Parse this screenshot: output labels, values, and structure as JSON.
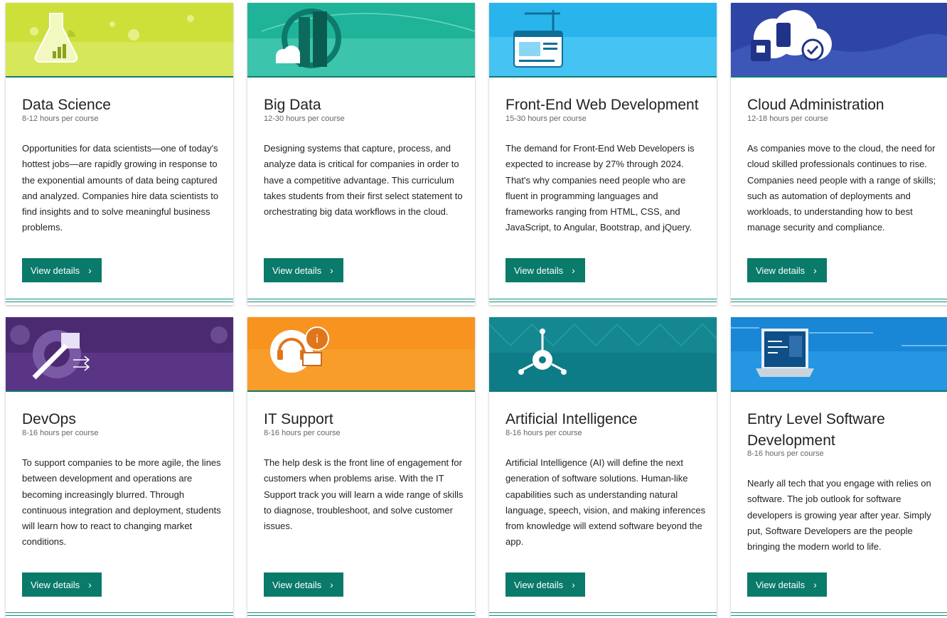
{
  "button_label": "View details",
  "chevron": "›",
  "cards": [
    {
      "title": "Data Science",
      "hours": "8-12 hours per course",
      "description": "Opportunities for data scientists—one of today's hottest jobs—are rapidly growing in response to the exponential amounts of data being captured and analyzed. Companies hire data scientists to find insights and to solve meaningful business problems.",
      "banner_color": "#cde03a",
      "icon": "flask-chart-icon"
    },
    {
      "title": "Big Data",
      "hours": "12-30 hours per course",
      "description": "Designing systems that capture, process, and analyze data is critical for companies in order to have a competitive advantage. This curriculum takes students from their first select statement to orchestrating big data workflows in the cloud.",
      "banner_color": "#1fb49a",
      "icon": "buildings-cloud-icon"
    },
    {
      "title": "Front-End Web Development",
      "hours": "15-30 hours per course",
      "description": "The demand for Front-End Web Developers is expected to increase by 27% through 2024. That's why companies need people who are fluent in programming languages and frameworks ranging from HTML, CSS, and JavaScript, to Angular, Bootstrap, and jQuery.",
      "banner_color": "#29b5ec",
      "icon": "webpage-crane-icon"
    },
    {
      "title": "Cloud Administration",
      "hours": "12-18 hours per course",
      "description": "As companies move to the cloud, the need for cloud skilled professionals continues to rise. Companies need people with a range of skills; such as automation of deployments and workloads, to understanding how to best manage security and compliance.",
      "banner_color": "#2f45a6",
      "icon": "cloud-lock-check-icon"
    },
    {
      "title": "DevOps",
      "hours": "8-16 hours per course",
      "description": "To support companies to be more agile, the lines between development and operations are becoming increasingly blurred. Through continuous integration and deployment, students will learn how to react to changing market conditions.",
      "banner_color": "#4b2a72",
      "icon": "gear-wrench-icon"
    },
    {
      "title": "IT Support",
      "hours": "8-16 hours per course",
      "description": "The help desk is the front line of engagement for customers when problems arise. With the IT Support track you will learn a wide range of skills to diagnose, troubleshoot, and solve customer issues.",
      "banner_color": "#f7931e",
      "icon": "headset-info-icon"
    },
    {
      "title": "Artificial Intelligence",
      "hours": "8-16 hours per course",
      "description": "Artificial Intelligence (AI) will define the next generation of software solutions. Human-like capabilities such as understanding natural language, speech, vision, and making inferences from knowledge will extend software beyond the app.",
      "banner_color": "#0e7c86",
      "icon": "neural-network-icon"
    },
    {
      "title": "Entry Level Software Development",
      "hours": "8-16 hours per course",
      "description": "Nearly all tech that you engage with relies on software. The job outlook for software developers is growing year after year. Simply put, Software Developers are the people bringing the modern world to life.",
      "banner_color": "#1a86d6",
      "icon": "laptop-code-icon"
    }
  ]
}
